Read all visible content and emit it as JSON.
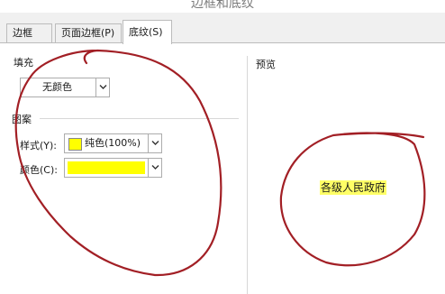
{
  "window": {
    "title": "边框和底纹"
  },
  "tabs": [
    {
      "label": "边框(B)"
    },
    {
      "label": "页面边框(P)"
    },
    {
      "label": "底纹(S)",
      "selected": true
    }
  ],
  "fill": {
    "section_label": "填充",
    "dropdown_value": "无颜色"
  },
  "pattern": {
    "section_label": "图案",
    "style_label": "样式(Y):",
    "style_value": "纯色(100%)",
    "color_label": "颜色(C):",
    "color_value": "#ffff00"
  },
  "preview": {
    "section_label": "预览",
    "sample_text": "各级人民政府",
    "highlight_color": "#ffff66"
  },
  "colors": {
    "annotation": "#a21f25",
    "swatch_fill": "#ffff00"
  },
  "icons": {
    "dropdown_arrow": "chevron-down-icon"
  }
}
